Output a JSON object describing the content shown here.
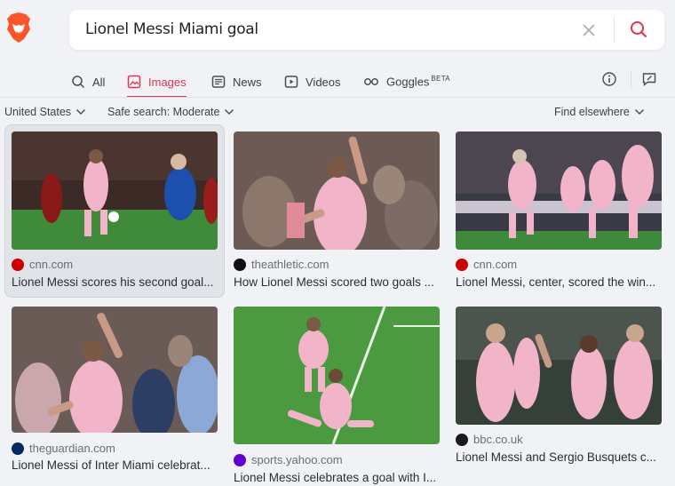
{
  "search": {
    "query": "Lionel Messi Miami goal"
  },
  "tabs": [
    {
      "label": "All",
      "icon": "search-icon"
    },
    {
      "label": "Images",
      "icon": "image-icon",
      "active": true
    },
    {
      "label": "News",
      "icon": "news-icon"
    },
    {
      "label": "Videos",
      "icon": "video-icon"
    },
    {
      "label": "Goggles",
      "icon": "goggles-icon",
      "badge": "BETA"
    }
  ],
  "filters": {
    "region": "United States",
    "safe_search": "Safe search: Moderate",
    "find_elsewhere": "Find elsewhere"
  },
  "results": [
    {
      "source": "cnn.com",
      "caption": "Lionel Messi scores his second goal...",
      "favicon": "cnn-icon"
    },
    {
      "source": "theathletic.com",
      "caption": "How Lionel Messi scored two goals ...",
      "favicon": "athletic-icon"
    },
    {
      "source": "cnn.com",
      "caption": "Lionel Messi, center, scored the win...",
      "favicon": "cnn-icon"
    },
    {
      "source": "theguardian.com",
      "caption": "Lionel Messi of Inter Miami celebrat...",
      "favicon": "guardian-icon"
    },
    {
      "source": "sports.yahoo.com",
      "caption": "Lionel Messi celebrates a goal with I...",
      "favicon": "yahoo-icon"
    },
    {
      "source": "bbc.co.uk",
      "caption": "Lionel Messi and Sergio Busquets c...",
      "favicon": "bbc-icon"
    }
  ],
  "colors": {
    "accent": "#e0334f",
    "brave_orange": "#fb542b",
    "pink_kit": "#f2b4c9"
  }
}
